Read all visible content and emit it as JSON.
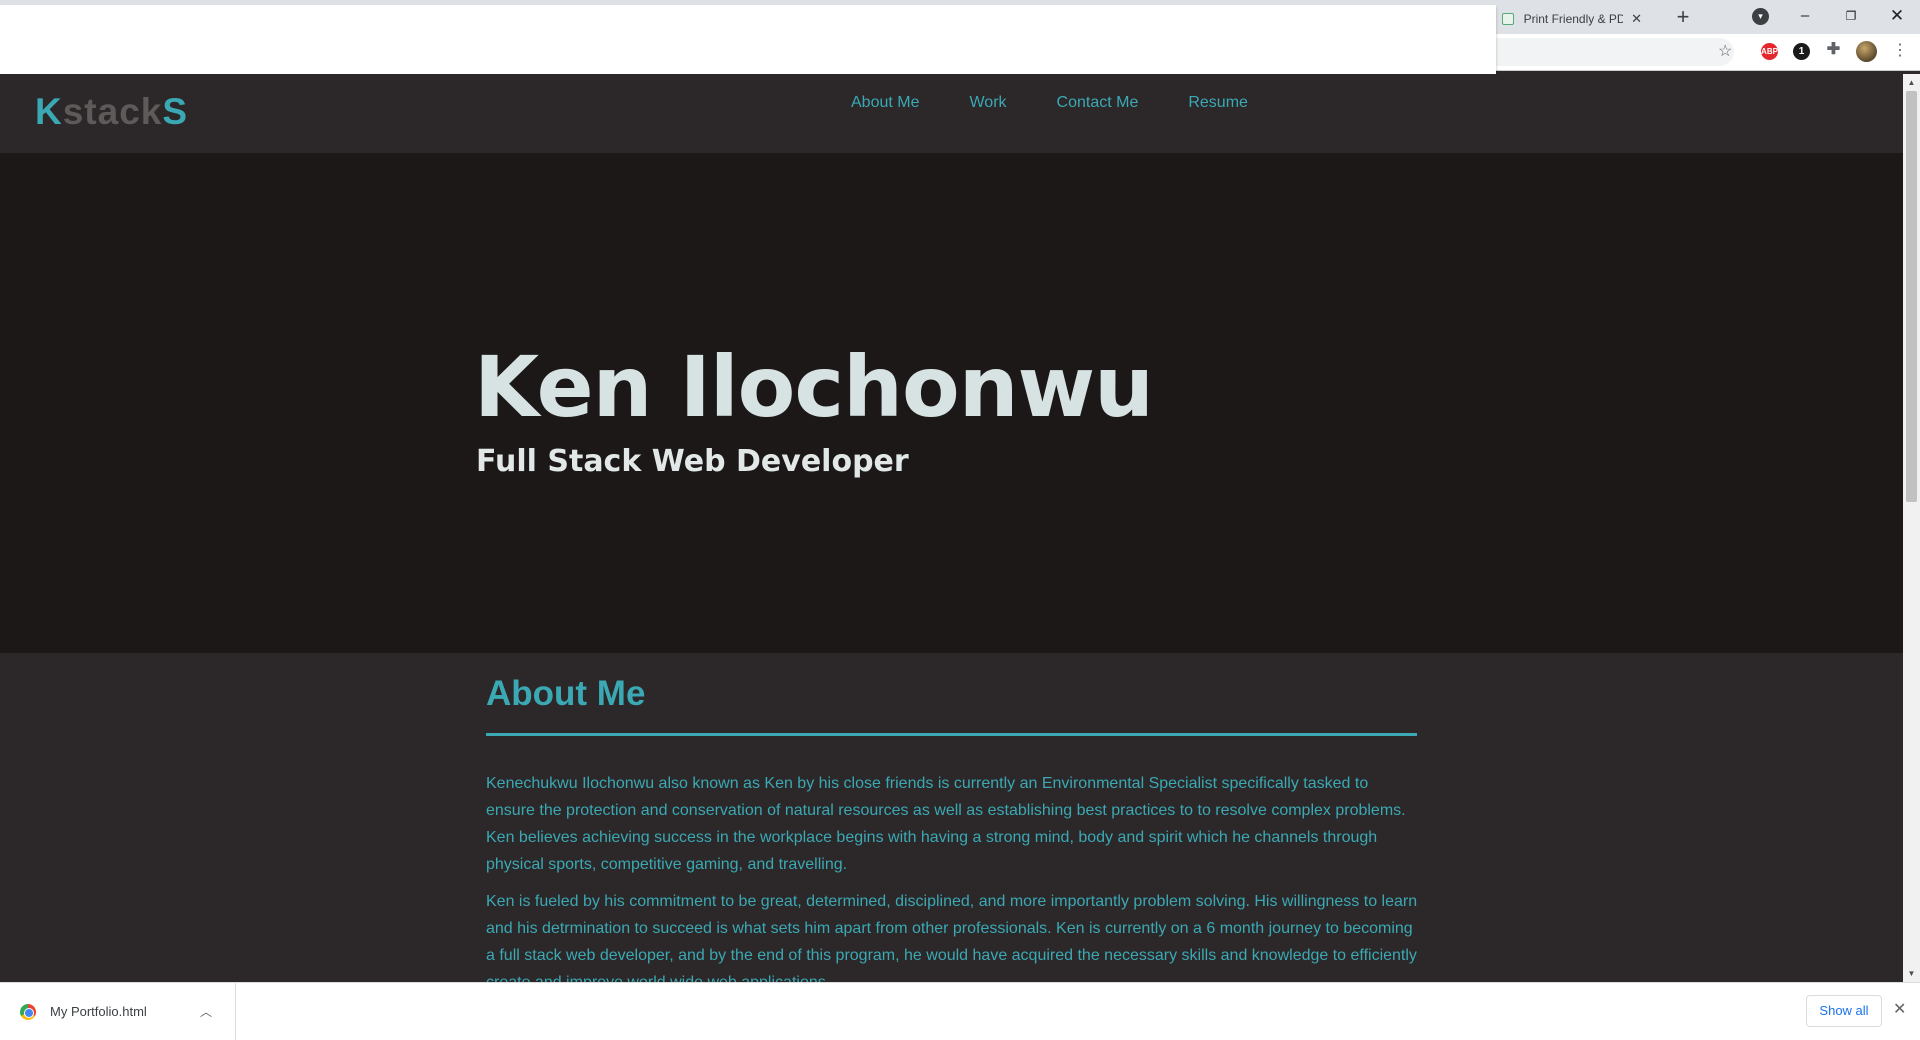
{
  "browser": {
    "tab_title": "Print Friendly & PD",
    "tab_close": "✕",
    "new_tab": "+",
    "window_min": "–",
    "window_max": "❐",
    "window_close": "✕",
    "extensions": {
      "abp": "ABP",
      "onepassword": "1"
    }
  },
  "site": {
    "logo": {
      "part1": "K",
      "part2": "stack",
      "part3": "S"
    },
    "nav": [
      "About Me",
      "Work",
      "Contact Me",
      "Resume"
    ],
    "hero": {
      "name": "Ken Ilochonwu",
      "title": "Full Stack Web Developer"
    },
    "about": {
      "heading": "About Me",
      "paragraphs": [
        "Kenechukwu Ilochonwu also known as Ken by his close friends is currently an Environmental Specialist specifically tasked to ensure the protection and conservation of natural resources as well as establishing best practices to to resolve complex problems. Ken believes achieving success in the workplace begins with having a strong mind, body and spirit which he channels through physical sports, competitive gaming, and travelling.",
        "Ken is fueled by his commitment to be great, determined, disciplined, and more importantly problem solving. His willingness to learn and his detrmination to succeed is what sets him apart from other professionals. Ken is currently on a 6 month journey to becoming a full stack web developer, and by the end of this program, he would have acquired the necessary skills and knowledge to efficiently create and improve world wide web applications."
      ]
    },
    "colors": {
      "accent": "#3aa9b4",
      "hero_bg": "#1c1818",
      "page_bg": "#2c2728"
    }
  },
  "downloads": {
    "file_name": "My Portfolio.html",
    "show_all": "Show all"
  }
}
